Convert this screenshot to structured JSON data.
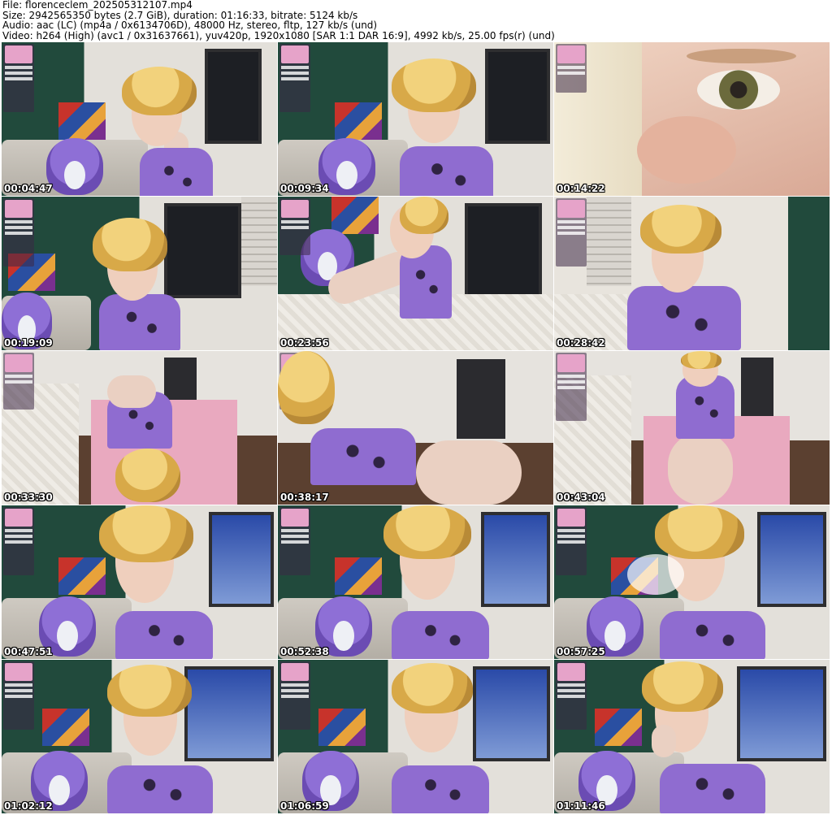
{
  "header": {
    "file_line": "File: florenceclem_202505312107.mp4",
    "size_line": "Size: 2942565350 bytes (2.7 GiB), duration: 01:16:33, bitrate: 5124 kb/s",
    "audio_line": "Audio: aac (LC) (mp4a / 0x6134706D), 48000 Hz, stereo, fltp, 127 kb/s (und)",
    "video_line": "Video: h264 (High) (avc1 / 0x31637661), yuv420p, 1920x1080 [SAR 1:1 DAR 16:9], 4992 kb/s, 25.00 fps(r) (und)"
  },
  "thumbnails": [
    {
      "timestamp": "00:04:47"
    },
    {
      "timestamp": "00:09:34"
    },
    {
      "timestamp": "00:14:22"
    },
    {
      "timestamp": "00:19:09"
    },
    {
      "timestamp": "00:23:56"
    },
    {
      "timestamp": "00:28:42"
    },
    {
      "timestamp": "00:33:30"
    },
    {
      "timestamp": "00:38:17"
    },
    {
      "timestamp": "00:43:04"
    },
    {
      "timestamp": "00:47:51"
    },
    {
      "timestamp": "00:52:38"
    },
    {
      "timestamp": "00:57:25"
    },
    {
      "timestamp": "01:02:12"
    },
    {
      "timestamp": "01:06:59"
    },
    {
      "timestamp": "01:11:46"
    }
  ],
  "colors": {
    "background": "#ffffff",
    "timestamp_text": "#ffffff",
    "timestamp_outline": "#000000",
    "top_purple": "#8f6cd0",
    "hair_blonde": "#e1b556"
  }
}
